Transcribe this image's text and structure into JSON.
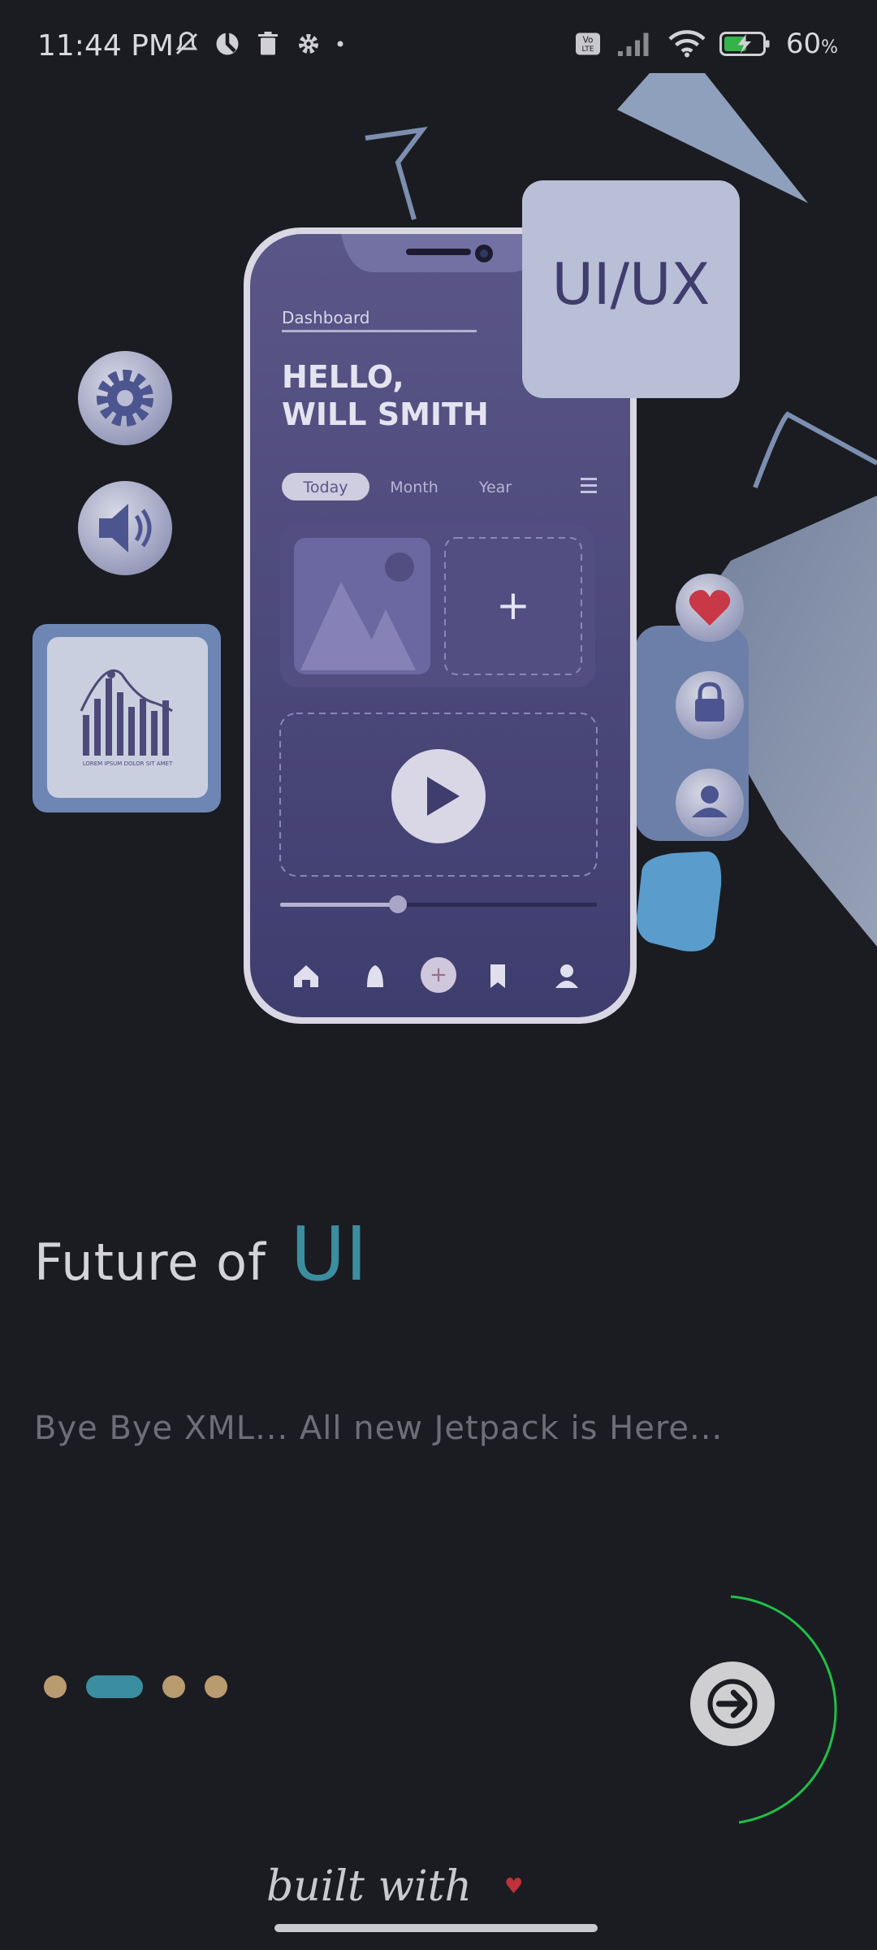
{
  "status_bar": {
    "time": "11:44 PM",
    "battery_value": "60",
    "battery_unit": "%",
    "icons_left": [
      "mute-bell-icon",
      "data-saver-icon",
      "trash-icon",
      "gear-icon",
      "dot-icon"
    ],
    "icons_right": [
      "volte-icon",
      "signal-icon",
      "wifi-icon",
      "battery-charging-icon"
    ]
  },
  "illustration": {
    "phone_screen": {
      "section_label": "Dashboard",
      "greeting_line1": "HELLO,",
      "greeting_line2": "WILL SMITH",
      "tabs": [
        "Today",
        "Month",
        "Year"
      ],
      "active_tab": "Today"
    },
    "badge_text": "UI/UX",
    "chart_card_caption": "LOREM IPSUM DOLOR SIT AMET",
    "float_icons": [
      "gear-icon",
      "speaker-icon",
      "heart-icon",
      "lock-icon",
      "user-icon"
    ]
  },
  "content": {
    "headline_prefix": "Future of",
    "headline_accent": "UI",
    "subtitle": "Bye Bye XML... All new Jetpack is Here..."
  },
  "pager": {
    "count": 4,
    "active_index": 1,
    "progress_fraction": 0.5
  },
  "footer": {
    "built_with": "built with",
    "heart": "♥"
  },
  "colors": {
    "background": "#1b1c21",
    "accent": "#3b8ea0",
    "dot": "#b99b70",
    "progress_ring": "#1ec04a",
    "heart": "#c0323a"
  }
}
